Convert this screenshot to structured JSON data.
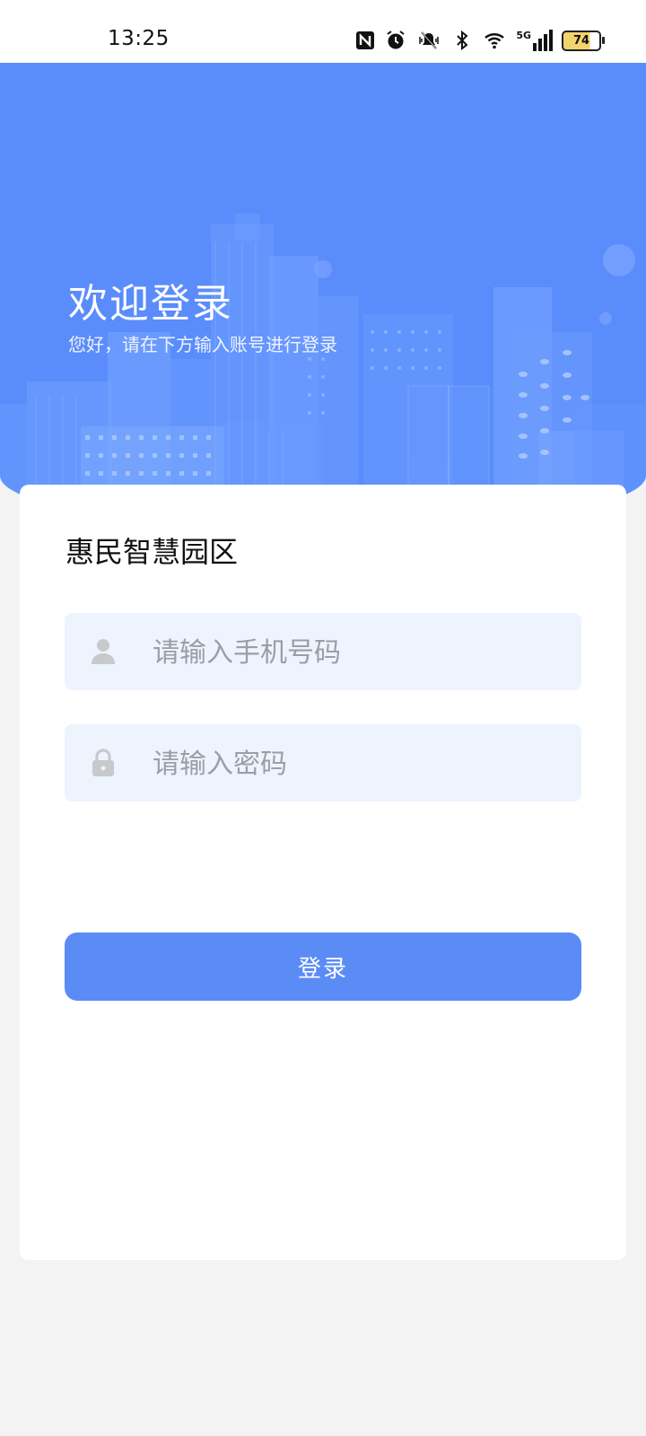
{
  "status_bar": {
    "time": "13:25",
    "icons": [
      "nfc-icon",
      "alarm-icon",
      "mute-vibrate-icon",
      "bluetooth-icon",
      "wifi-icon",
      "5g-signal-icon",
      "battery-icon"
    ],
    "signal_label": "5G",
    "battery": "74"
  },
  "hero": {
    "title": "欢迎登录",
    "subtitle": "您好，请在下方输入账号进行登录",
    "background_color": "#5a8cfb"
  },
  "card": {
    "app_name": "惠民智慧园区",
    "phone_field": {
      "placeholder": "请输入手机号码",
      "value": "",
      "icon": "user-icon"
    },
    "password_field": {
      "placeholder": "请输入密码",
      "value": "",
      "icon": "lock-icon"
    },
    "login_button": "登录",
    "accent_color": "#5b8cf6"
  }
}
